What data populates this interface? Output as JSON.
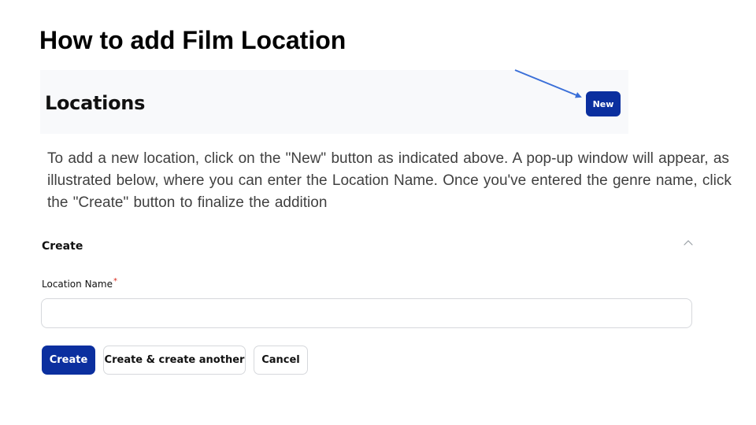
{
  "slide": {
    "title": "How to add Film Location"
  },
  "locations_panel": {
    "heading": "Locations",
    "new_button_label": "New"
  },
  "instructions": {
    "text": "To add a new location, click on the \"New\" button as indicated above. A pop-up window will appear, as illustrated below, where you can enter the Location Name. Once you've entered the genre name, click the \"Create\" button to finalize the addition"
  },
  "create_modal": {
    "title": "Create",
    "field_label": "Location Name",
    "required_marker": "*",
    "field_value": "",
    "field_placeholder": "",
    "buttons": {
      "create": "Create",
      "create_another": "Create & create another",
      "cancel": "Cancel"
    }
  },
  "icons": {
    "close": "close-icon",
    "annotation_arrow": "arrow-icon"
  },
  "colors": {
    "primary": "#0b2f9f",
    "arrow": "#3a6fd8",
    "required": "#d92d20",
    "panel_background": "#f8f9fb"
  }
}
